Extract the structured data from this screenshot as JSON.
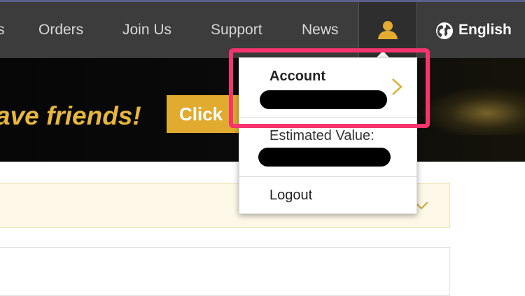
{
  "nav": {
    "edge_fragment": "s",
    "items": [
      "Orders",
      "Join Us",
      "Support",
      "News"
    ],
    "language": "English",
    "user_icon": "user-icon",
    "globe_icon": "globe-icon"
  },
  "banner": {
    "tagline": "ave friends!",
    "cta_label": "Click"
  },
  "dropdown": {
    "account_label": "Account",
    "estimated_label": "Estimated Value:",
    "logout_label": "Logout"
  },
  "colors": {
    "accent": "#e0ab2e",
    "highlight": "#f7346f",
    "nav_bg": "#3c3c3c"
  }
}
